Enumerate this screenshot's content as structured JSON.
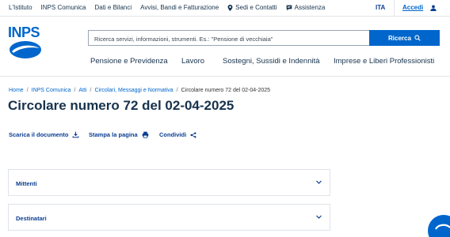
{
  "topbar": {
    "links": [
      "L'Istituto",
      "INPS Comunica",
      "Dati e Bilanci",
      "Avvisi, Bandi e Fatturazione",
      "Sedi e Contatti",
      "Assistenza"
    ],
    "lang": "ITA",
    "login": "Accedi"
  },
  "header": {
    "logo": "INPS",
    "search_placeholder": "Ricerca servizi, informazioni, strumenti. Es.: \"Pensione di vecchiaia\"",
    "search_button": "Ricerca"
  },
  "nav": [
    "Pensione e Previdenza",
    "Lavoro",
    "Sostegni, Sussidi e Indennità",
    "Imprese e Liberi Professionisti"
  ],
  "breadcrumb": {
    "items": [
      "Home",
      "INPS Comunica",
      "Atti",
      "Circolari, Messaggi e Normativa"
    ],
    "current": "Circolare numero 72 del 02-04-2025"
  },
  "page": {
    "title": "Circolare numero 72 del 02-04-2025"
  },
  "actions": {
    "download": "Scarica il documento",
    "print": "Stampa la pagina",
    "share": "Condividi"
  },
  "accordions": [
    "Mittenti",
    "Destinatari"
  ],
  "colors": {
    "brand": "#0066cc",
    "navy": "#17324d"
  }
}
